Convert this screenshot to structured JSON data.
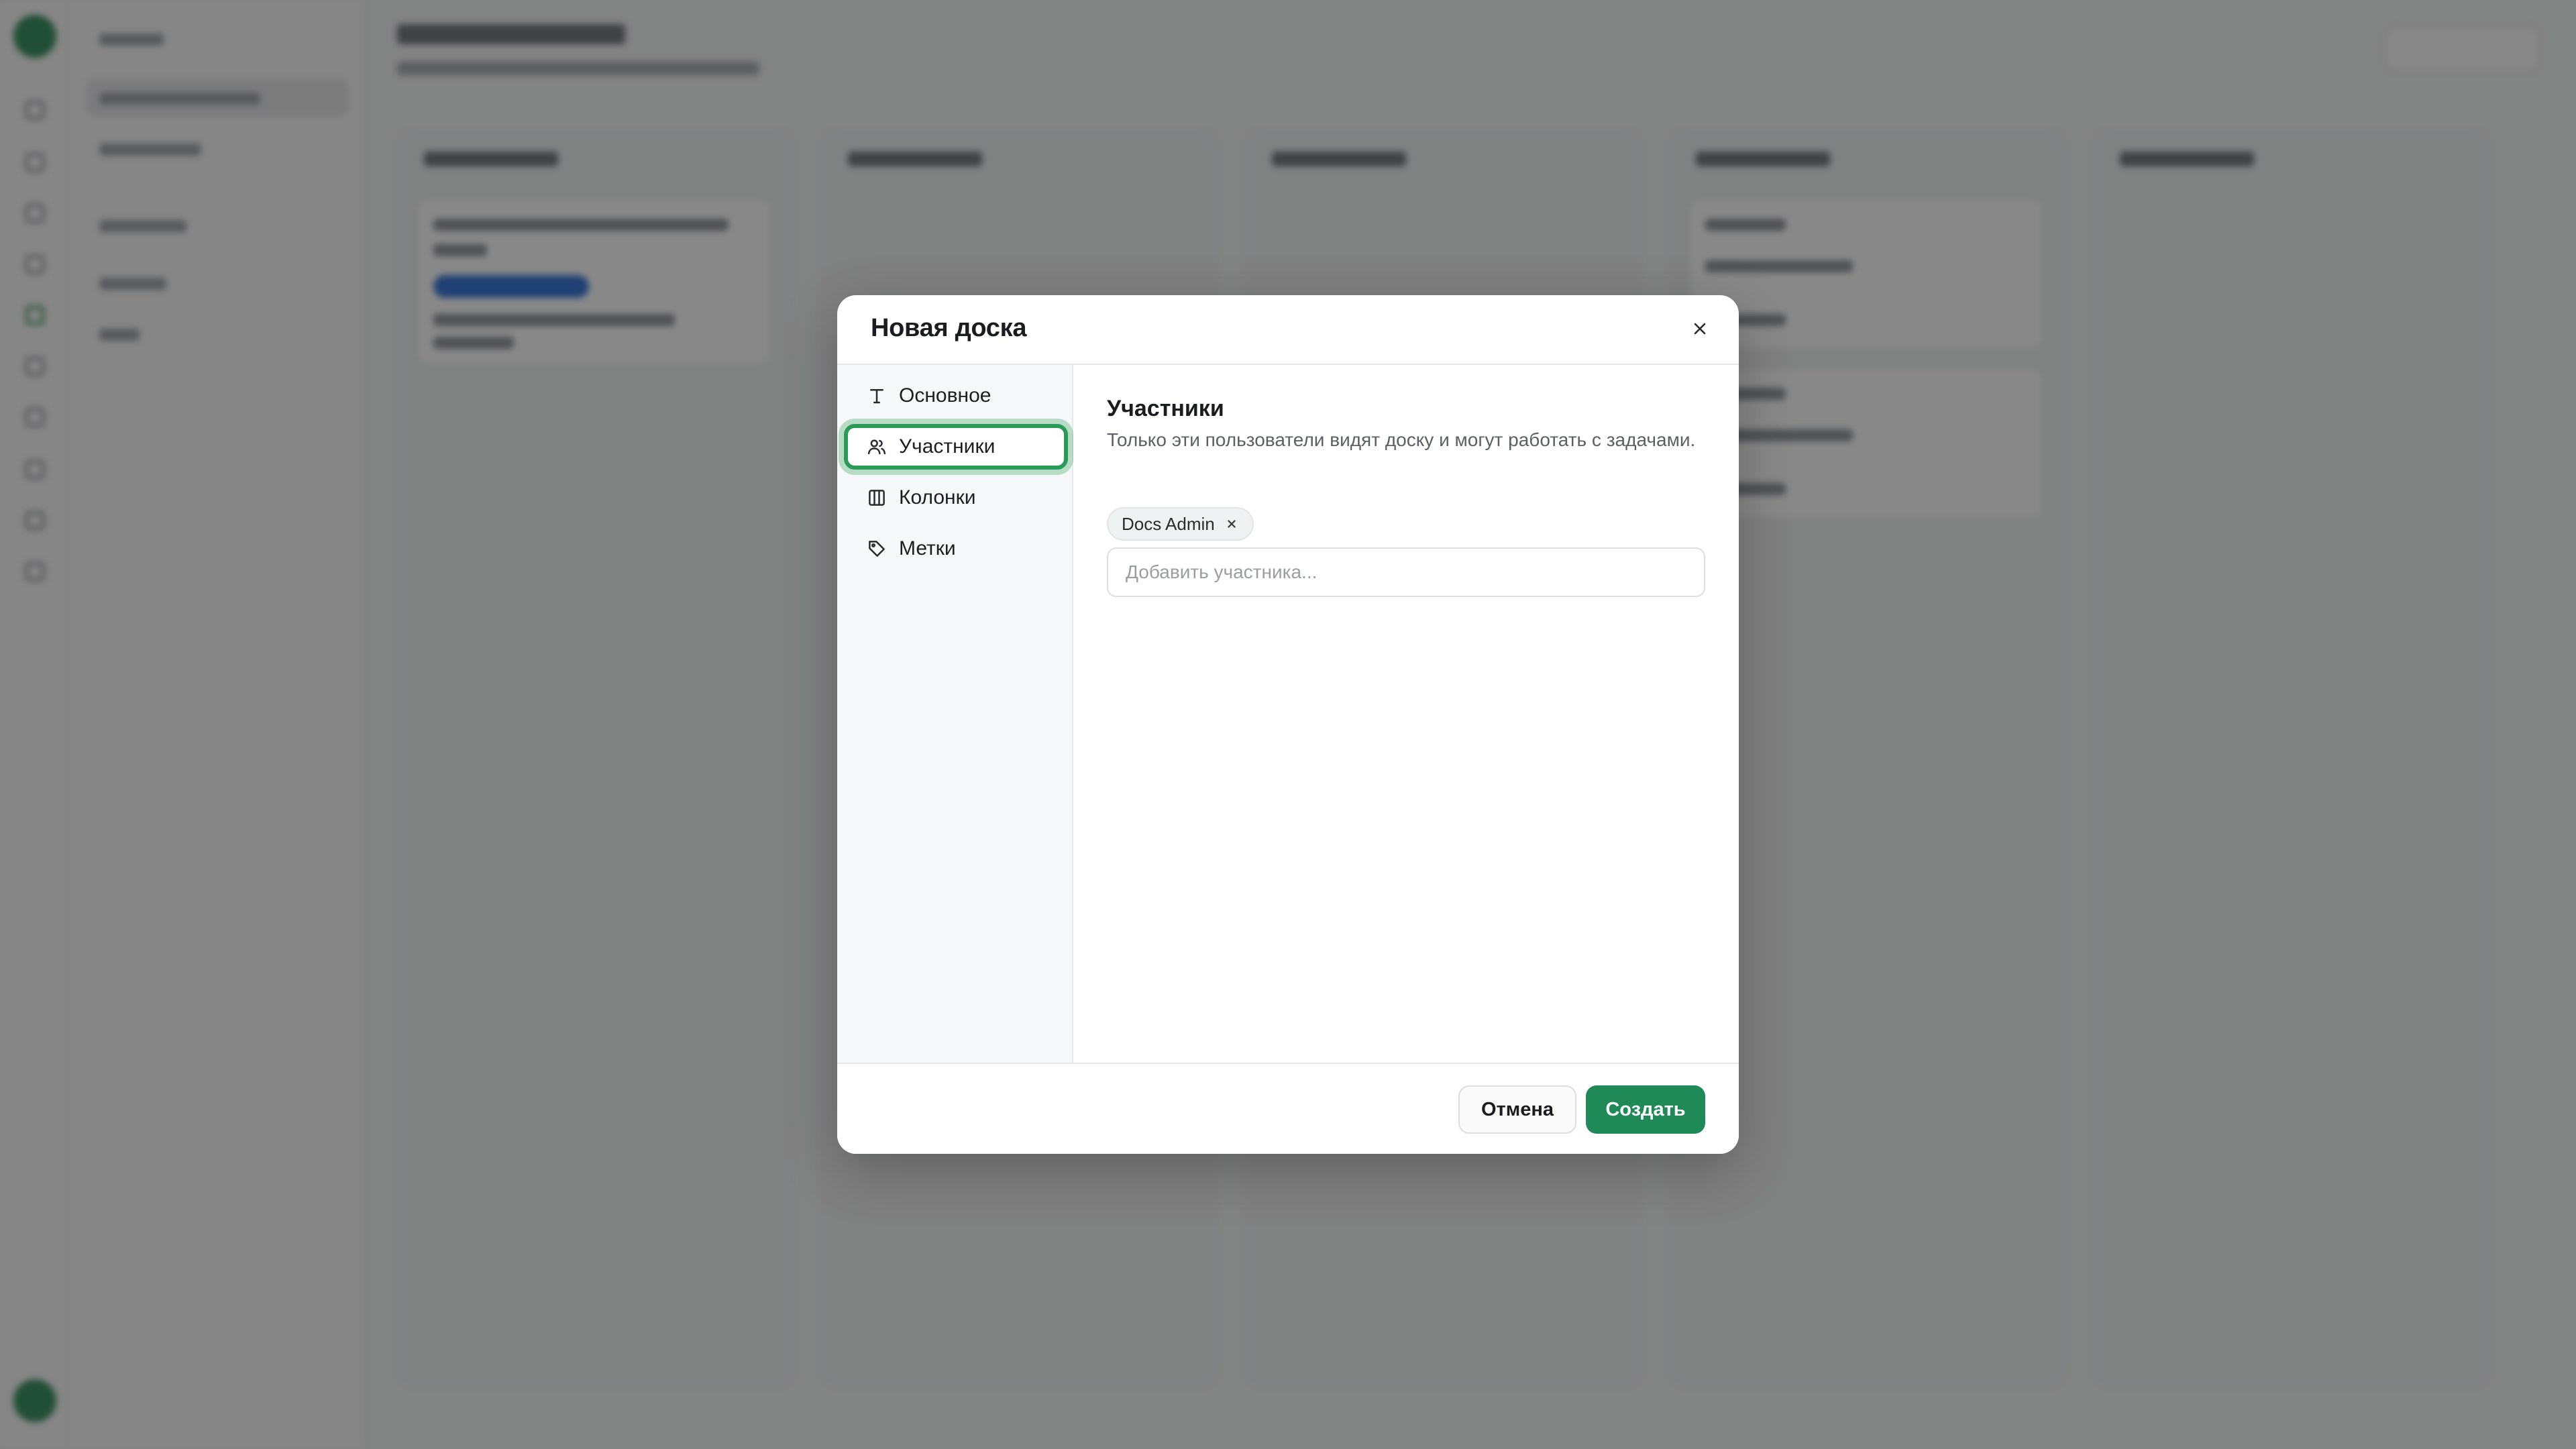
{
  "dialog": {
    "title": "Новая доска",
    "nav": [
      {
        "label": "Основное",
        "icon": "text-icon"
      },
      {
        "label": "Участники",
        "icon": "users-icon"
      },
      {
        "label": "Колонки",
        "icon": "columns-icon"
      },
      {
        "label": "Метки",
        "icon": "tag-icon"
      }
    ],
    "active_nav": "Участники",
    "section": {
      "title": "Участники",
      "description": "Только эти пользователи видят доску и могут работать с задачами."
    },
    "members": [
      {
        "name": "Docs Admin"
      }
    ],
    "member_input": {
      "value": "",
      "placeholder": "Добавить участника..."
    },
    "footer": {
      "cancel_label": "Отмена",
      "create_label": "Создать"
    }
  },
  "colors": {
    "accent": "#1f8a57",
    "highlight": "#2a9a57",
    "overlay": "rgba(18,18,18,0.5)"
  }
}
